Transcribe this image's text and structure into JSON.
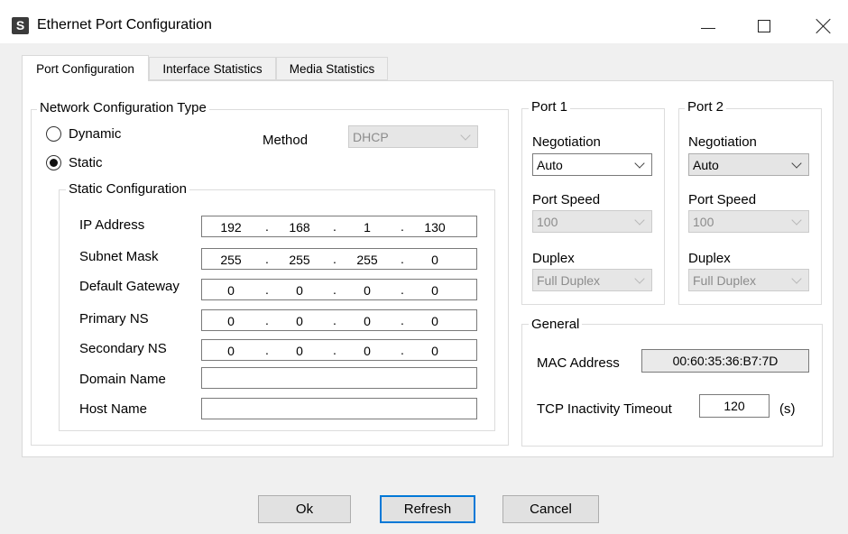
{
  "window": {
    "icon_letter": "S",
    "title": "Ethernet Port Configuration"
  },
  "tabs": [
    {
      "label": "Port Configuration",
      "active": true
    },
    {
      "label": "Interface Statistics",
      "active": false
    },
    {
      "label": "Media Statistics",
      "active": false
    }
  ],
  "network": {
    "group_title": "Network Configuration Type",
    "dynamic_label": "Dynamic",
    "static_label": "Static",
    "selected": "Static",
    "method_label": "Method",
    "method_value": "DHCP"
  },
  "static_config": {
    "group_title": "Static Configuration",
    "ip_address": {
      "label": "IP Address",
      "octets": [
        "192",
        "168",
        "1",
        "130"
      ]
    },
    "subnet_mask": {
      "label": "Subnet Mask",
      "octets": [
        "255",
        "255",
        "255",
        "0"
      ]
    },
    "default_gateway": {
      "label": "Default Gateway",
      "octets": [
        "0",
        "0",
        "0",
        "0"
      ]
    },
    "primary_ns": {
      "label": "Primary NS",
      "octets": [
        "0",
        "0",
        "0",
        "0"
      ]
    },
    "secondary_ns": {
      "label": "Secondary NS",
      "octets": [
        "0",
        "0",
        "0",
        "0"
      ]
    },
    "domain_name": {
      "label": "Domain Name",
      "value": ""
    },
    "host_name": {
      "label": "Host Name",
      "value": ""
    }
  },
  "port1": {
    "title": "Port 1",
    "negotiation_label": "Negotiation",
    "negotiation_value": "Auto",
    "speed_label": "Port Speed",
    "speed_value": "100",
    "duplex_label": "Duplex",
    "duplex_value": "Full Duplex"
  },
  "port2": {
    "title": "Port 2",
    "negotiation_label": "Negotiation",
    "negotiation_value": "Auto",
    "speed_label": "Port Speed",
    "speed_value": "100",
    "duplex_label": "Duplex",
    "duplex_value": "Full Duplex"
  },
  "general": {
    "title": "General",
    "mac_label": "MAC Address",
    "mac_value": "00:60:35:36:B7:7D",
    "tcp_label": "TCP Inactivity Timeout",
    "tcp_value": "120",
    "tcp_unit": "(s)"
  },
  "buttons": {
    "ok": "Ok",
    "refresh": "Refresh",
    "cancel": "Cancel"
  },
  "colors": {
    "focus_border": "#0078d7",
    "window_bg": "#f0f0f0"
  }
}
